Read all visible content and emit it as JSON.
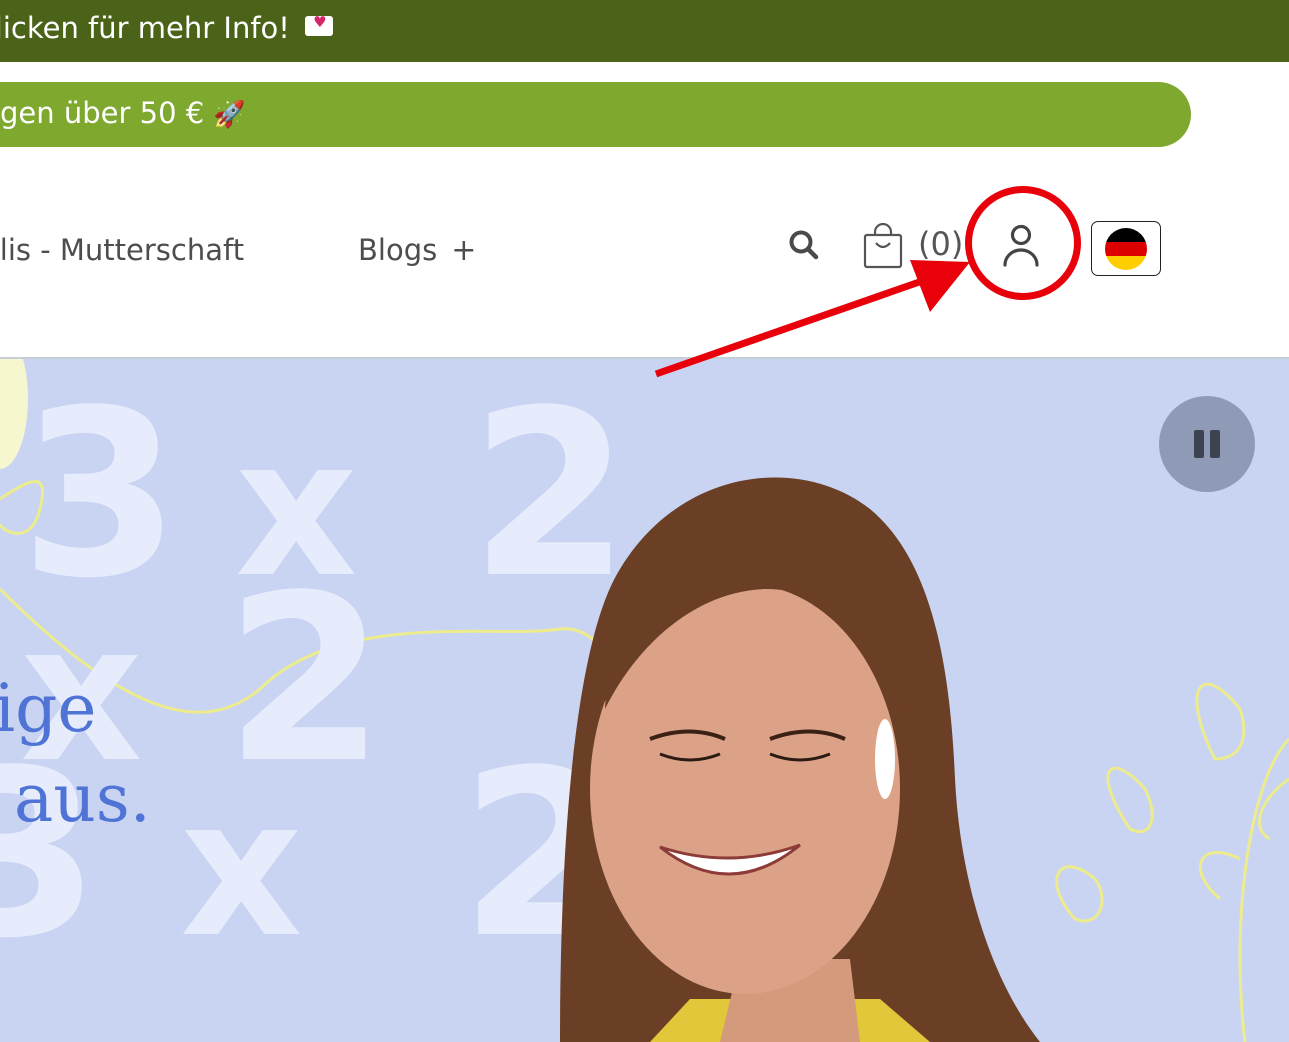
{
  "announcement": {
    "text": "klicken für mehr Info!",
    "icon": "love-letter-icon"
  },
  "promo": {
    "text": "gen über 50 €",
    "icon": "rocket-icon"
  },
  "nav": {
    "items": [
      {
        "label": "alis - Mutterschaft"
      },
      {
        "label": "Blogs",
        "expand": "+"
      }
    ]
  },
  "header_actions": {
    "cart_count": "(0)",
    "language": "Deutsch",
    "icons": [
      "search-icon",
      "shopping-bag-icon",
      "user-icon",
      "germany-flag-icon"
    ]
  },
  "annotation": {
    "color": "#e8000b"
  },
  "hero": {
    "line1": "ige",
    "line2": "aus.",
    "pause_icon": "pause-icon",
    "background_color": "#c9d4f3",
    "text_color": "#4f74d6"
  },
  "colors": {
    "topbar": "#4b6319",
    "promo": "#7fa82f"
  }
}
